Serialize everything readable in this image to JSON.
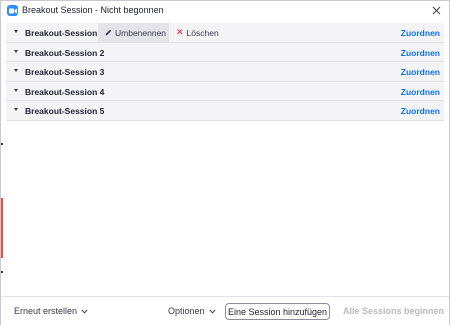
{
  "window": {
    "title": "Breakout Session - Nicht begonnen",
    "accent_color": "#2d8cff"
  },
  "sessions": [
    {
      "name": "Breakout-Session 1",
      "assign_label": "Zuordnen",
      "expanded_actions": true
    },
    {
      "name": "Breakout-Session 2",
      "assign_label": "Zuordnen"
    },
    {
      "name": "Breakout-Session 3",
      "assign_label": "Zuordnen"
    },
    {
      "name": "Breakout-Session 4",
      "assign_label": "Zuordnen"
    },
    {
      "name": "Breakout-Session 5",
      "assign_label": "Zuordnen"
    }
  ],
  "row_actions": {
    "rename_label": "Umbenennen",
    "delete_label": "Löschen",
    "delete_color": "#e02828"
  },
  "footer": {
    "recreate_label": "Erneut erstellen",
    "options_label": "Optionen",
    "add_session_label": "Eine Session hinzufügen",
    "open_all_label": "Alle Sessions beginnen"
  },
  "colors": {
    "link_blue": "#0e71eb",
    "disabled_text": "#b8b8c0"
  }
}
